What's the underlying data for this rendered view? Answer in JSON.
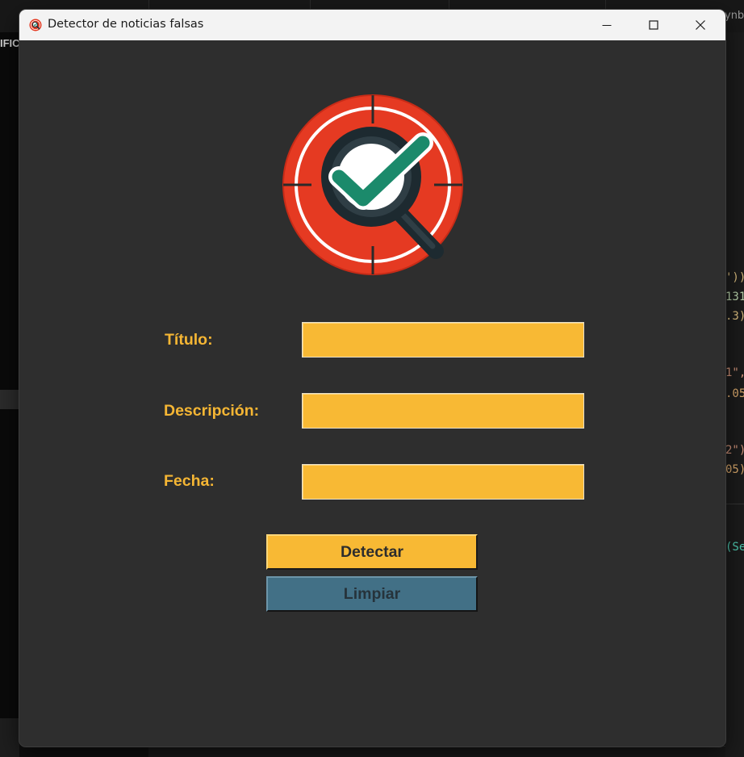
{
  "window": {
    "title": "Detector de noticias falsas",
    "controls": [
      "minimize-icon",
      "maximize-icon",
      "close-icon"
    ]
  },
  "logo": {
    "icon": "fact-check-magnifier-logo"
  },
  "form": {
    "fields": [
      {
        "label": "Título:",
        "value": "",
        "placeholder": ""
      },
      {
        "label": "Descripción:",
        "value": "",
        "placeholder": ""
      },
      {
        "label": "Fecha:",
        "value": "",
        "placeholder": ""
      }
    ]
  },
  "buttons": {
    "detect": "Detectar",
    "clear": "Limpiar"
  },
  "background": {
    "left_label": "IFIC",
    "top_right": "ynb",
    "code_lines": [
      "'))",
      "131",
      ".3)",
      "1\",",
      ".05",
      "2\")",
      "05)",
      "(Se"
    ]
  },
  "colors": {
    "accent": "#f8b934",
    "label": "#f5b634",
    "secondary_button": "#427086",
    "window_bg": "#2e2e2e",
    "logo_red": "#e53a22",
    "logo_check": "#1b8a6b"
  }
}
